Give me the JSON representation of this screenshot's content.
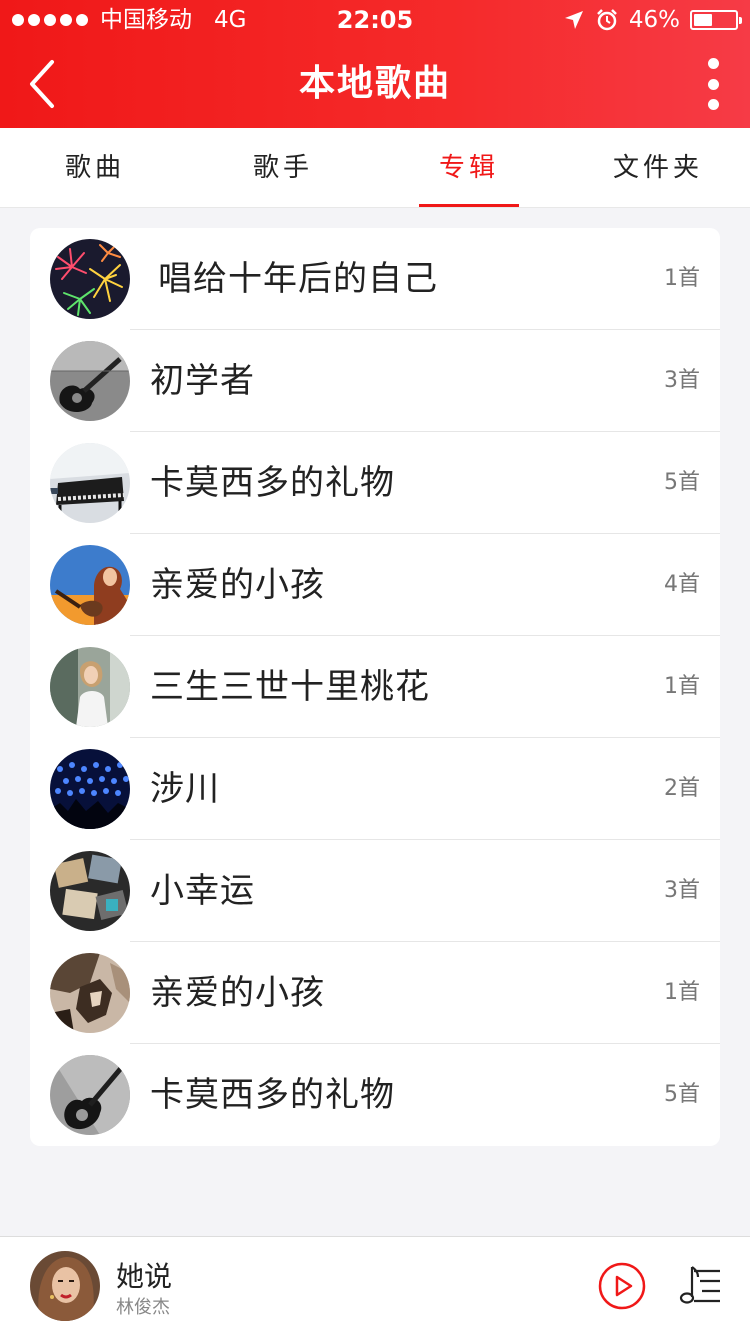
{
  "status_bar": {
    "carrier": "中国移动",
    "network": "4G",
    "time": "22:05",
    "battery": "46%",
    "battery_level": 0.46,
    "icons": [
      "location-arrow-icon",
      "alarm-clock-icon",
      "battery-icon"
    ]
  },
  "nav": {
    "title": "本地歌曲",
    "back_icon": "back-chevron-icon",
    "more_icon": "more-vertical-icon"
  },
  "tabs": [
    {
      "label": "歌曲",
      "active": false
    },
    {
      "label": "歌手",
      "active": false
    },
    {
      "label": "专辑",
      "active": true
    },
    {
      "label": "文件夹",
      "active": false
    }
  ],
  "albums": [
    {
      "name": "唱给十年后的自己",
      "count": "1首"
    },
    {
      "name": "初学者",
      "count": "3首"
    },
    {
      "name": "卡莫西多的礼物",
      "count": "5首"
    },
    {
      "name": "亲爱的小孩",
      "count": "4首"
    },
    {
      "name": "三生三世十里桃花",
      "count": "1首"
    },
    {
      "name": "涉川",
      "count": "2首"
    },
    {
      "name": "小幸运",
      "count": "3首"
    },
    {
      "name": "亲爱的小孩",
      "count": "1首"
    },
    {
      "name": "卡莫西多的礼物",
      "count": "5首"
    }
  ],
  "player": {
    "title": "她说",
    "artist": "林俊杰",
    "play_icon": "play-circle-icon",
    "playlist_icon": "playlist-icon"
  },
  "colors": {
    "accent": "#f01818",
    "header_gradient_end": "#f63b46",
    "background": "#f4f4f7"
  }
}
